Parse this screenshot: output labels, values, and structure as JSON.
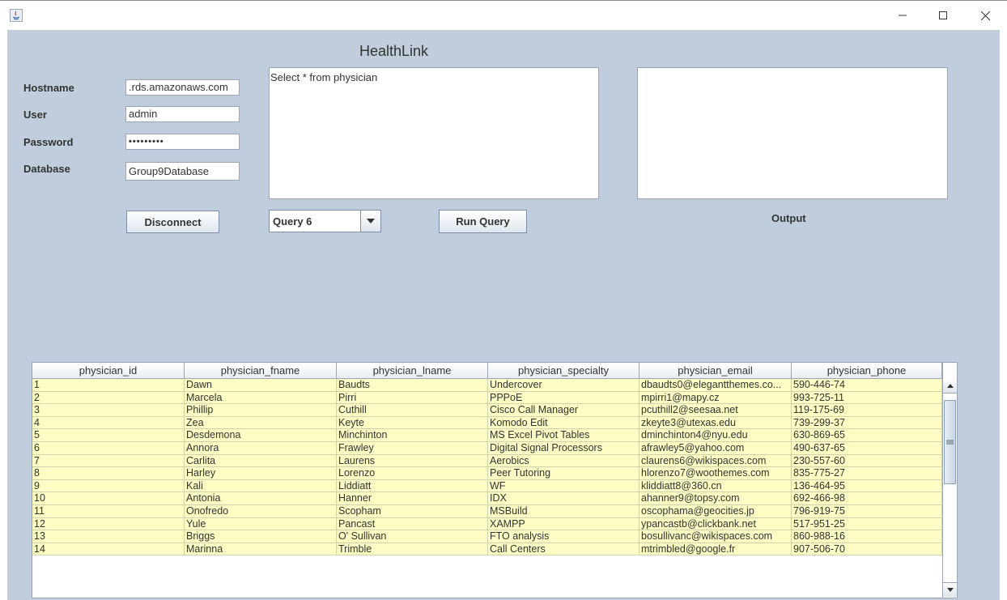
{
  "window": {
    "minimize_glyph": "—",
    "maximize_glyph": "☐",
    "close_glyph": "✕"
  },
  "app": {
    "title": "HealthLink"
  },
  "connection": {
    "hostname_label": "Hostname",
    "hostname_value": ".rds.amazonaws.com",
    "user_label": "User",
    "user_value": "admin",
    "password_label": "Password",
    "password_value": "•••••••••",
    "database_label": "Database",
    "database_value": "Group9Database",
    "disconnect_label": "Disconnect"
  },
  "query": {
    "text": "Select * from physician",
    "selected": "Query 6",
    "run_label": "Run Query"
  },
  "output": {
    "label": "Output",
    "text": ""
  },
  "table": {
    "columns": [
      "physician_id",
      "physician_fname",
      "physician_lname",
      "physician_specialty",
      "physician_email",
      "physician_phone"
    ],
    "rows": [
      [
        "1",
        "Dawn",
        "Baudts",
        "Undercover",
        "dbaudts0@elegantthemes.co...",
        "590-446-74"
      ],
      [
        "2",
        "Marcela",
        "Pirri",
        "PPPoE",
        "mpirri1@mapy.cz",
        "993-725-11"
      ],
      [
        "3",
        "Phillip",
        "Cuthill",
        "Cisco Call Manager",
        "pcuthill2@seesaa.net",
        "119-175-69"
      ],
      [
        "4",
        "Zea",
        "Keyte",
        "Komodo Edit",
        "zkeyte3@utexas.edu",
        "739-299-37"
      ],
      [
        "5",
        "Desdemona",
        "Minchinton",
        "MS Excel Pivot Tables",
        "dminchinton4@nyu.edu",
        "630-869-65"
      ],
      [
        "6",
        "Annora",
        "Frawley",
        "Digital Signal Processors",
        "afrawley5@yahoo.com",
        "490-637-65"
      ],
      [
        "7",
        "Carlita",
        "Laurens",
        "Aerobics",
        "claurens6@wikispaces.com",
        "230-557-60"
      ],
      [
        "8",
        "Harley",
        "Lorenzo",
        "Peer Tutoring",
        "hlorenzo7@woothemes.com",
        "835-775-27"
      ],
      [
        "9",
        "Kali",
        "Liddiatt",
        "WF",
        "kliddiatt8@360.cn",
        "136-464-95"
      ],
      [
        "10",
        "Antonia",
        "Hanner",
        "IDX",
        "ahanner9@topsy.com",
        "692-466-98"
      ],
      [
        "11",
        "Onofredo",
        "Scopham",
        "MSBuild",
        "oscophama@geocities.jp",
        "796-919-75"
      ],
      [
        "12",
        "Yule",
        "Pancast",
        "XAMPP",
        "ypancastb@clickbank.net",
        "517-951-25"
      ],
      [
        "13",
        "Briggs",
        "O' Sullivan",
        "FTO analysis",
        "bosullivanc@wikispaces.com",
        "860-988-16"
      ],
      [
        "14",
        "Marinna",
        "Trimble",
        "Call Centers",
        "mtrimbled@google.fr",
        "907-506-70"
      ]
    ]
  }
}
